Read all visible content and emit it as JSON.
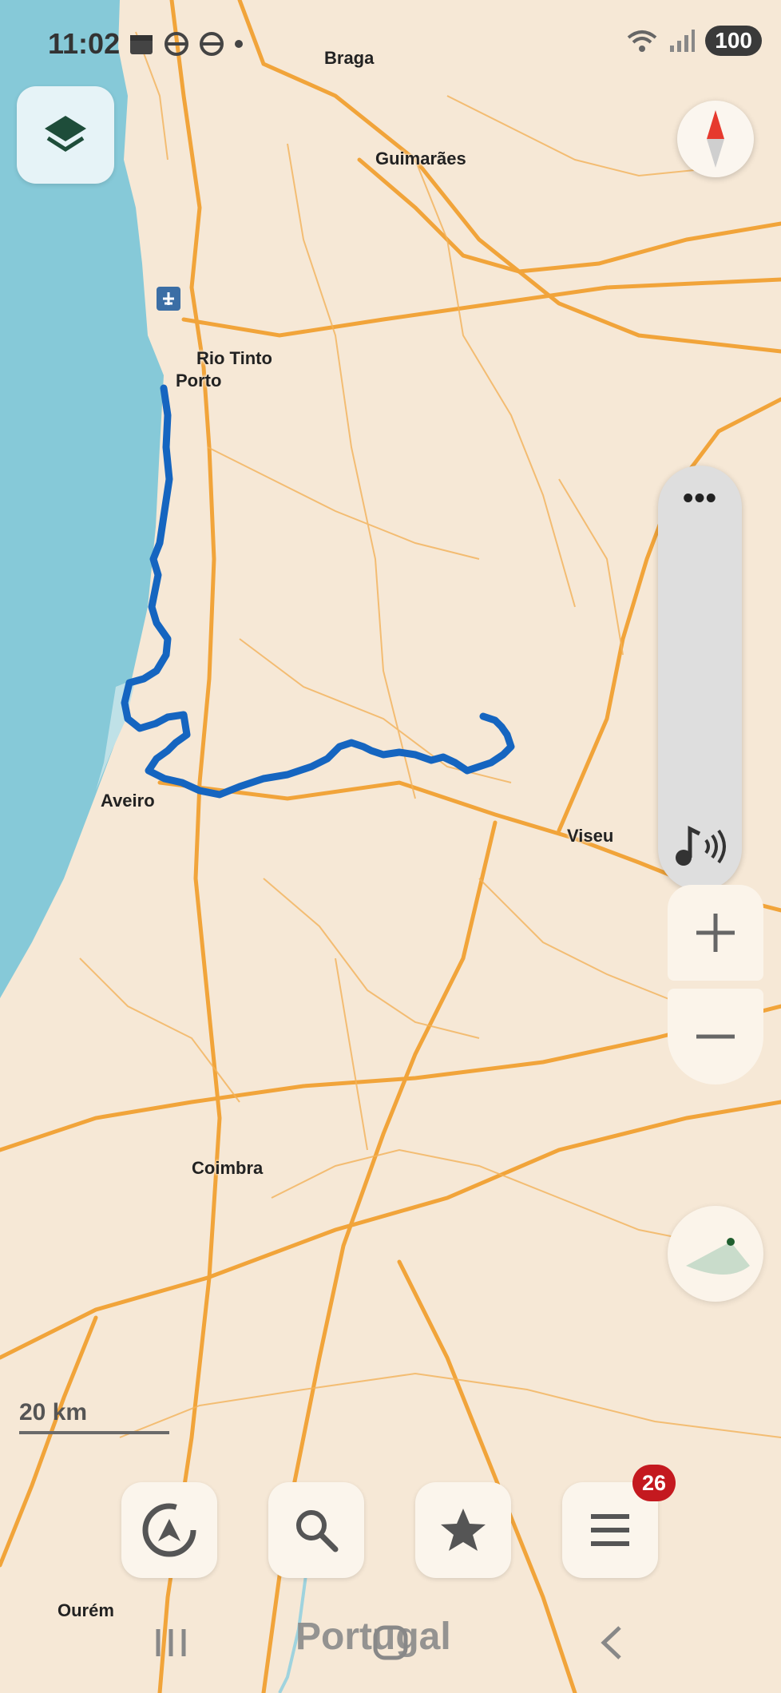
{
  "status_bar": {
    "time": "11:02",
    "battery": "100"
  },
  "icons": {
    "layers": "layers-icon",
    "compass": "compass-icon",
    "more": "more-icon",
    "sound": "sound-icon",
    "zoom_in": "plus-icon",
    "zoom_out": "minus-icon",
    "location": "my-location-icon",
    "route": "route-icon",
    "search": "search-icon",
    "bookmarks": "star-icon",
    "menu": "menu-icon"
  },
  "map": {
    "cities": [
      {
        "name": "Braga"
      },
      {
        "name": "Guimarães"
      },
      {
        "name": "Rio Tinto"
      },
      {
        "name": "Porto"
      },
      {
        "name": "Aveiro"
      },
      {
        "name": "Viseu"
      },
      {
        "name": "Coimbra"
      },
      {
        "name": "Ourém"
      }
    ],
    "country": "Portugal",
    "track_color": "#1565c0",
    "sea_color": "#86c9d8",
    "land_color": "#f6e8d6",
    "road_color": "#f1a43a"
  },
  "controls": {
    "more_label": "•••"
  },
  "scale": {
    "label": "20 km"
  },
  "bottom_bar": {
    "menu_badge": "26"
  }
}
